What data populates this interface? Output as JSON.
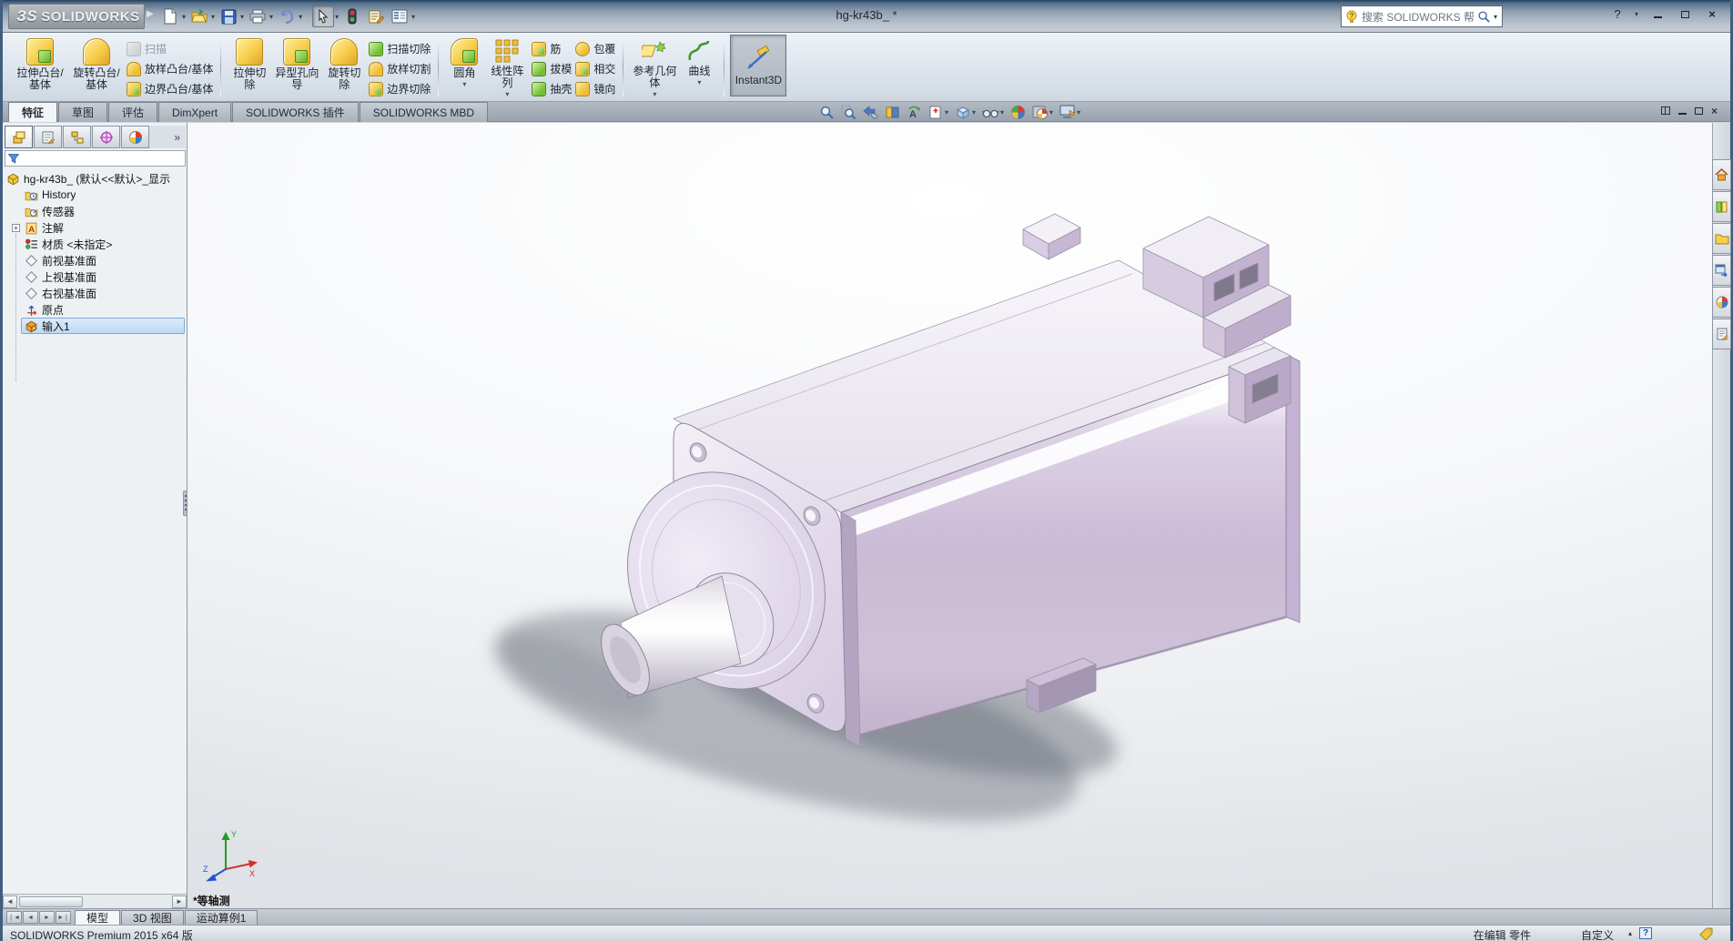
{
  "window": {
    "brand": "SOLIDWORKS",
    "brand_prefix": "ЗS",
    "title": "hg-kr43b_  *",
    "search_placeholder": "搜索 SOLIDWORKS 帮助"
  },
  "colors": {
    "selection": "#bcd9f5",
    "motor_lavender": "#cdbdd8",
    "titlebar_top": "#24415e",
    "ribbon_bg": "#dde4ec"
  },
  "quick_access_icons": [
    "new-document",
    "open",
    "save",
    "print",
    "undo",
    "select-cursor",
    "traffic-light",
    "file-properties",
    "options-list"
  ],
  "ribbon": {
    "tabs": [
      {
        "label": "特征",
        "active": true
      },
      {
        "label": "草图"
      },
      {
        "label": "评估"
      },
      {
        "label": "DimXpert"
      },
      {
        "label": "SOLIDWORKS 插件"
      },
      {
        "label": "SOLIDWORKS MBD"
      }
    ],
    "groups": [
      {
        "big": [
          {
            "label": "拉伸凸台/基体"
          },
          {
            "label": "旋转凸台/基体"
          }
        ],
        "small": [
          {
            "label": "扫描",
            "disabled": true
          },
          {
            "label": "放样凸台/基体"
          },
          {
            "label": "边界凸台/基体"
          }
        ]
      },
      {
        "big": [
          {
            "label": "拉伸切除"
          },
          {
            "label": "异型孔向导"
          },
          {
            "label": "旋转切除"
          }
        ],
        "small": [
          {
            "label": "扫描切除"
          },
          {
            "label": "放样切割"
          },
          {
            "label": "边界切除"
          }
        ]
      },
      {
        "big": [
          {
            "label": "圆角",
            "dropdown": "▾"
          },
          {
            "label": "线性阵列",
            "dropdown": "▾"
          }
        ],
        "small_col1": [
          {
            "label": "筋"
          },
          {
            "label": "拔模"
          },
          {
            "label": "抽壳"
          }
        ],
        "small_col2": [
          {
            "label": "包覆"
          },
          {
            "label": "相交"
          },
          {
            "label": "镜向"
          }
        ]
      },
      {
        "big": [
          {
            "label": "参考几何体",
            "dropdown": "▾"
          },
          {
            "label": "曲线",
            "dropdown": "▾"
          }
        ]
      },
      {
        "toggle": {
          "label": "Instant3D",
          "active": true
        }
      }
    ]
  },
  "headsup_icons": [
    "zoom-to-fit",
    "zoom-to-area",
    "previous-view",
    "section-view",
    "dynamic-annotation-views",
    "view-orientation",
    "display-style",
    "hide-show-items",
    "edit-appearance",
    "apply-scene",
    "view-settings"
  ],
  "feature_panel": {
    "tab_icons": [
      "featuremanager",
      "propertymanager",
      "configurationmanager",
      "dimxpertmanager",
      "displaymanager"
    ],
    "overflow": "»",
    "tree": [
      {
        "label": "hg-kr43b_ (默认<<默认>_显示",
        "icon": "part"
      },
      {
        "label": "History",
        "icon": "history-folder"
      },
      {
        "label": "传感器",
        "icon": "sensors-folder"
      },
      {
        "label": "注解",
        "icon": "annotations-folder",
        "expandable": true
      },
      {
        "label": "材质 <未指定>",
        "icon": "material"
      },
      {
        "label": "前视基准面",
        "icon": "plane"
      },
      {
        "label": "上视基准面",
        "icon": "plane"
      },
      {
        "label": "右视基准面",
        "icon": "plane"
      },
      {
        "label": "原点",
        "icon": "origin"
      },
      {
        "label": "输入1",
        "icon": "imported-body",
        "selected": true
      }
    ]
  },
  "viewport": {
    "view_label": "*等轴测",
    "triad": {
      "x": "X",
      "y": "Y",
      "z": "Z"
    },
    "model": "servo-motor-part"
  },
  "task_pane_icons": [
    "solidworks-resources",
    "design-library",
    "file-explorer",
    "view-palette",
    "appearances-scenes",
    "custom-properties"
  ],
  "doc_tabs": [
    {
      "label": "模型",
      "active": true
    },
    {
      "label": "3D 视图"
    },
    {
      "label": "运动算例1"
    }
  ],
  "status_bar": {
    "left": "SOLIDWORKS Premium 2015 x64 版",
    "mode": "在编辑 零件",
    "custom": "自定义"
  }
}
